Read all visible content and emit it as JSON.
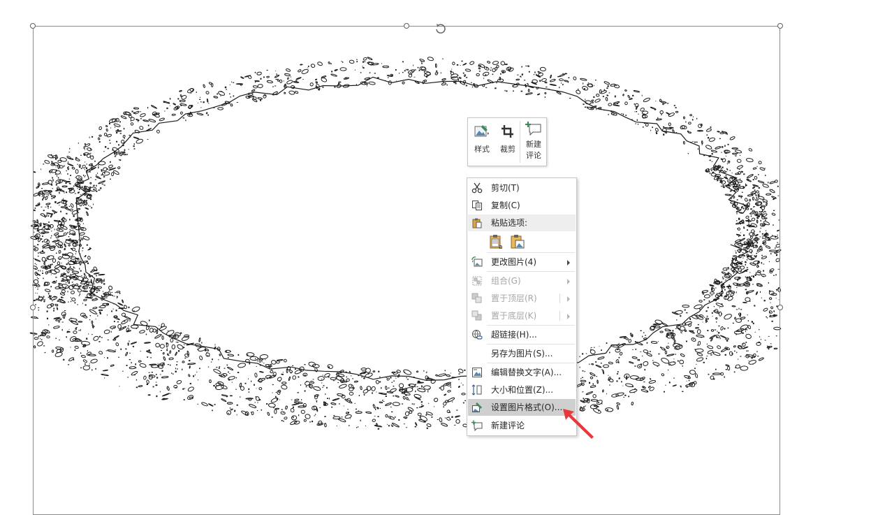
{
  "mini_toolbar": {
    "style_label": "样式",
    "crop_label": "裁剪",
    "new_comment_label_line1": "新建",
    "new_comment_label_line2": "评论"
  },
  "context_menu": {
    "items": [
      {
        "label": "剪切(T)",
        "icon": "scissors-icon",
        "enabled": true
      },
      {
        "label": "复制(C)",
        "icon": "copy-icon",
        "enabled": true
      },
      {
        "label": "粘贴选项:",
        "icon": "clipboard-icon",
        "enabled": true
      },
      {
        "label": "更改图片(4)",
        "icon": "change-picture-icon",
        "enabled": true,
        "submenu": true
      },
      {
        "label": "组合(G)",
        "icon": "group-icon",
        "enabled": false,
        "submenu": true
      },
      {
        "label": "置于顶层(R)",
        "icon": "bring-to-front-icon",
        "enabled": false,
        "submenu": true
      },
      {
        "label": "置于底层(K)",
        "icon": "send-to-back-icon",
        "enabled": false,
        "submenu": true
      },
      {
        "label": "超链接(H)...",
        "icon": "hyperlink-icon",
        "enabled": true
      },
      {
        "label": "另存为图片(S)...",
        "icon": "",
        "enabled": true
      },
      {
        "label": "编辑替换文字(A)...",
        "icon": "alt-text-icon",
        "enabled": true
      },
      {
        "label": "大小和位置(Z)...",
        "icon": "size-position-icon",
        "enabled": true
      },
      {
        "label": "设置图片格式(O)...",
        "icon": "format-picture-icon",
        "enabled": true,
        "highlighted": true
      },
      {
        "label": "新建评论",
        "icon": "new-comment-icon",
        "enabled": true
      }
    ],
    "paste_options": [
      "paste-keep-text-icon",
      "paste-picture-icon"
    ]
  },
  "colors": {
    "accent_green": "#3a8a5c",
    "highlight_bg": "#cfcfcf",
    "disabled_text": "#a6a6a6",
    "pointer_red": "#e8383d"
  }
}
